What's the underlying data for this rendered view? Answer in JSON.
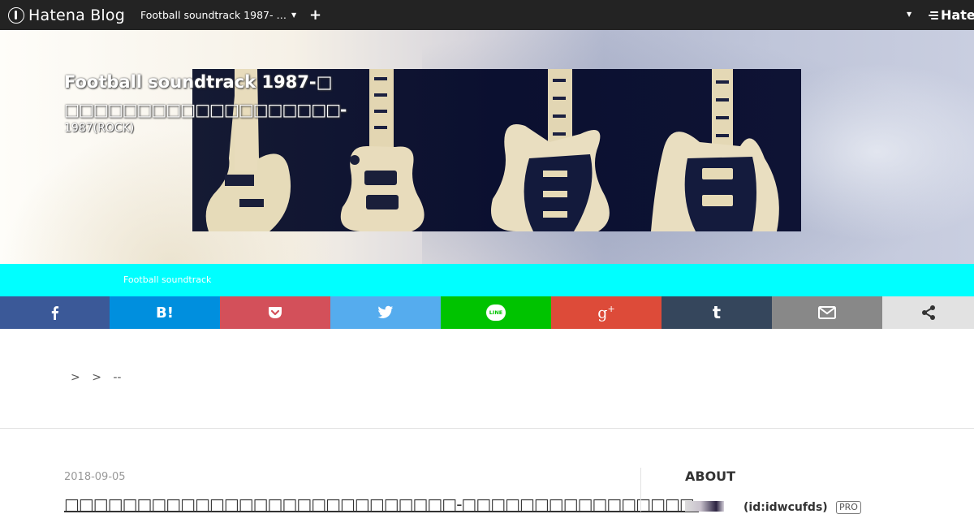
{
  "topbar": {
    "brand": "Hatena Blog",
    "blog_switch": "Football soundtrack 1987-  …",
    "plus": "+",
    "right_brand": "Hatena"
  },
  "header": {
    "title_line1": "Football soundtrack 1987-□",
    "title_line2": "□□□□□□□□□□□□□□□□□□□-",
    "description": "1987(ROCK)"
  },
  "nav": {
    "link": "Football soundtrack"
  },
  "share": {
    "buttons": [
      {
        "name": "facebook",
        "color": "#3b5998",
        "icon": "facebook-icon"
      },
      {
        "name": "hatena-bookmark",
        "color": "#008fde",
        "icon": "hatena-bookmark-icon"
      },
      {
        "name": "pocket",
        "color": "#d3505a",
        "icon": "pocket-icon"
      },
      {
        "name": "twitter",
        "color": "#55acee",
        "icon": "twitter-icon"
      },
      {
        "name": "line",
        "color": "#00c300",
        "icon": "line-icon",
        "label": "LINE"
      },
      {
        "name": "google-plus",
        "color": "#dd4b39",
        "icon": "google-plus-icon"
      },
      {
        "name": "tumblr",
        "color": "#35465c",
        "icon": "tumblr-icon"
      },
      {
        "name": "email",
        "color": "#888888",
        "icon": "email-icon"
      },
      {
        "name": "share",
        "color": "#e2e2e2",
        "icon": "share-icon"
      }
    ]
  },
  "breadcrumb": {
    "sep1": ">",
    "sep2": ">",
    "current": "--"
  },
  "article": {
    "date": "2018-09-05",
    "title": "□□□□□□□□□□□□□□□□□□□□□□□□□□□-□□□□□□□□□□□□□□□□-"
  },
  "sidebar": {
    "about_title": "ABOUT",
    "user_id": "(id:idwcufds)",
    "badge": "PRO"
  }
}
